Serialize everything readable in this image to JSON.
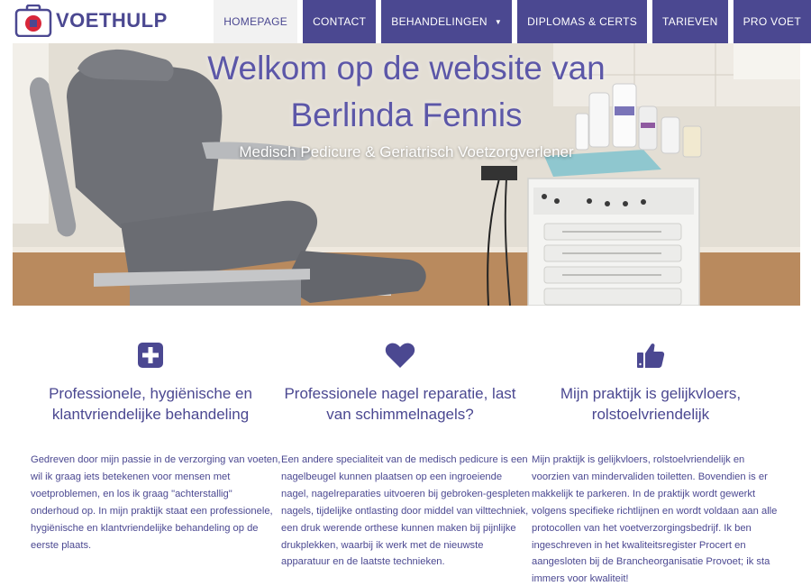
{
  "brand": {
    "name": "VOETHULP"
  },
  "nav": {
    "items": [
      {
        "label": "HOMEPAGE",
        "active": true
      },
      {
        "label": "CONTACT"
      },
      {
        "label": "BEHANDELINGEN",
        "has_dropdown": true
      },
      {
        "label": "DIPLOMAS & CERTS"
      },
      {
        "label": "TARIEVEN"
      },
      {
        "label": "PRO VOET"
      }
    ]
  },
  "hero": {
    "title_line1": "Welkom op de website van",
    "title_line2": "Berlinda Fennis",
    "subtitle": "Medisch Pedicure & Geriatrisch Voetzorgverlener",
    "image_subject": "pedicure-chair-and-equipment-cart"
  },
  "features": [
    {
      "icon": "plus-square-icon",
      "title_line1": "Professionele, hygiënische en",
      "title_line2": "klantvriendelijke behandeling",
      "body": "Gedreven door mijn passie in de verzorging van voeten, wil ik graag iets betekenen voor mensen met voetproblemen, en los ik graag \"achterstallig\" onderhoud op. In mijn praktijk staat een professionele, hygiënische en klantvriendelijke behandeling op de eerste plaats."
    },
    {
      "icon": "heart-icon",
      "title_line1": "Professionele nagel reparatie, last",
      "title_line2": "van schimmelnagels?",
      "body": "Een andere specialiteit van de medisch pedicure is een nagelbeugel kunnen plaatsen op een ingroeiende nagel, nagelreparaties uitvoeren bij gebroken-gespleten nagels, tijdelijke ontlasting door middel van vilttechniek, een druk werende orthese kunnen maken bij pijnlijke drukplekken, waarbij ik werk met de nieuwste apparatuur en de laatste technieken."
    },
    {
      "icon": "thumbs-up-icon",
      "title_line1": "Mijn praktijk is gelijkvloers,",
      "title_line2": "rolstoelvriendelijk",
      "body": "Mijn praktijk is gelijkvloers, rolstoelvriendelijk en voorzien van mindervaliden toiletten. Bovendien is er makkelijk te parkeren. In de praktijk wordt gewerkt volgens specifieke richtlijnen en wordt voldaan aan alle protocollen van het voetverzorgingsbedrijf. Ik ben ingeschreven in het kwaliteitsregister Procert en aangesloten bij de Brancheorganisatie Provoet; ik sta immers voor kwaliteit!"
    }
  ],
  "colors": {
    "accent": "#4b4891",
    "active_tab_bg": "#f2f2f2",
    "hero_title": "#5c57a8"
  }
}
